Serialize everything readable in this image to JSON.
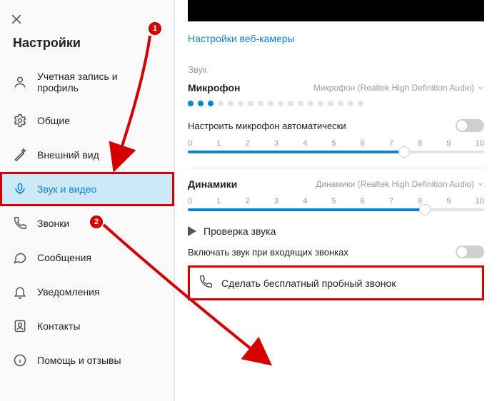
{
  "title": "Настройки",
  "webcam_link": "Настройки веб-камеры",
  "sound_label": "Звук",
  "mic": {
    "title": "Микрофон",
    "device": "Микрофон (Realtek High Definition Audio)",
    "auto_label": "Настроить микрофон автоматически",
    "value": 7.3,
    "active_dots": 3,
    "total_dots": 18
  },
  "speakers": {
    "title": "Динамики",
    "device": "Динамики (Realtek High Definition Audio)",
    "value": 8,
    "test_label": "Проверка звука"
  },
  "ring_label": "Включать звук при входящих звонках",
  "test_call_label": "Сделать бесплатный пробный звонок",
  "ticks": [
    "0",
    "1",
    "2",
    "3",
    "4",
    "5",
    "6",
    "7",
    "8",
    "9",
    "10"
  ],
  "nav": {
    "account": "Учетная запись и профиль",
    "general": "Общие",
    "appearance": "Внешний вид",
    "audio_video": "Звук и видео",
    "calling": "Звонки",
    "messaging": "Сообщения",
    "notifications": "Уведомления",
    "contacts": "Контакты",
    "help": "Помощь и отзывы"
  },
  "markers": {
    "m1": "1",
    "m2": "2"
  }
}
